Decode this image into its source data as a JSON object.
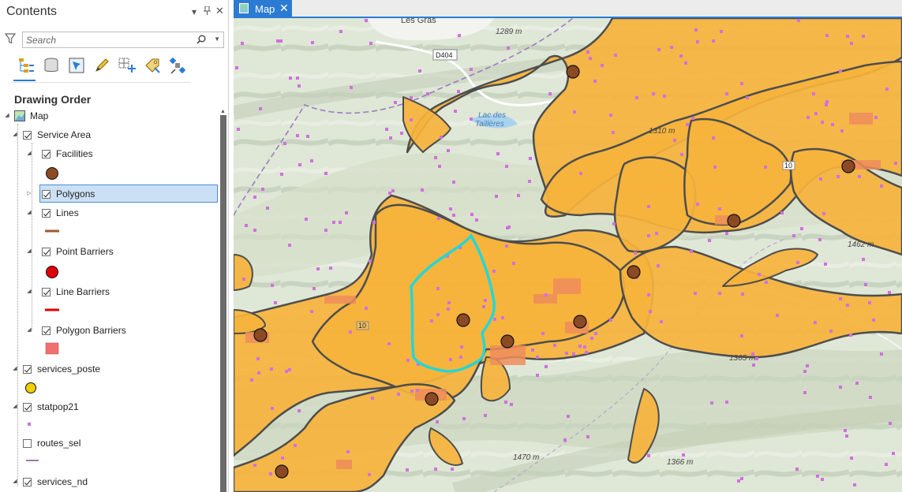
{
  "pane": {
    "title": "Contents",
    "search_placeholder": "Search",
    "section_title": "Drawing Order",
    "tools": [
      "list-by-drawing-order-icon",
      "list-by-data-source-icon",
      "list-by-selection-icon",
      "list-by-editing-icon",
      "list-by-snapping-icon",
      "list-by-labeling-icon",
      "list-by-perspective-imagery-icon"
    ]
  },
  "tree": {
    "map": "Map",
    "service_area": "Service Area",
    "facilities": "Facilities",
    "polygons": "Polygons",
    "lines": "Lines",
    "point_barriers": "Point Barriers",
    "line_barriers": "Line Barriers",
    "polygon_barriers": "Polygon Barriers",
    "services_poste": "services_poste",
    "statpop21": "statpop21",
    "routes_sel": "routes_sel",
    "services_nd": "services_nd"
  },
  "colors": {
    "facility": "#8b4a24",
    "line": "#9a5a2e",
    "point_barrier": "#e00000",
    "line_barrier": "#e00000",
    "polygon_barrier": "#f07070",
    "poste": "#f0d000",
    "statpop": "#d070e0",
    "routes": "#7050a0",
    "service_polygon": "#f6b33c",
    "selection": "#25d6d6",
    "accent": "#2b7bd3"
  },
  "map_tab": {
    "label": "Map"
  },
  "map_labels": {
    "les_gras": "Les Gras",
    "d404": "D404",
    "lac1": "Lac des",
    "lac2": "Taillères",
    "e1289": "1289 m",
    "e1310": "1310 m",
    "e1462": "1462 m",
    "e1365": "1365 m",
    "e1470": "1470 m",
    "e1366": "1366 m",
    "r10a": "10",
    "r10b": "10"
  }
}
